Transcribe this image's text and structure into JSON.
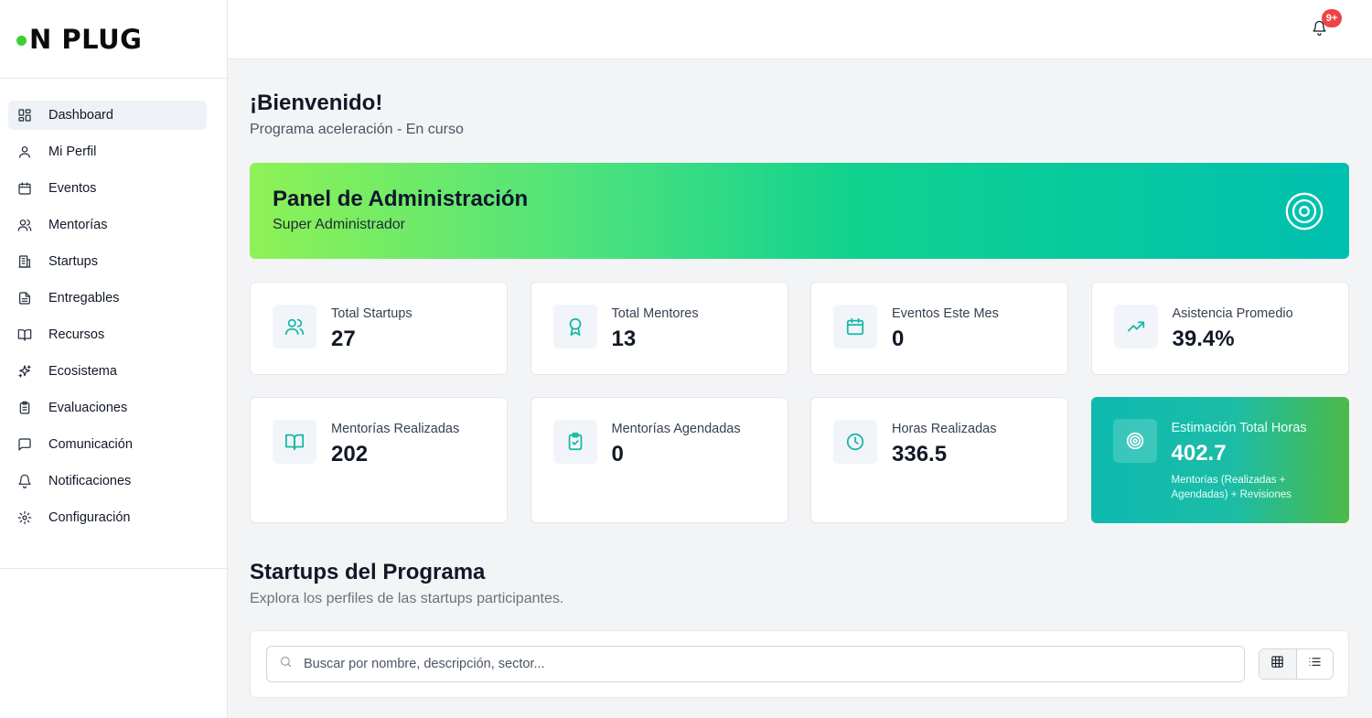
{
  "brand": {
    "name": "N PLUG",
    "dot_color": "#3ecf37"
  },
  "sidebar": {
    "items": [
      {
        "label": "Dashboard",
        "icon": "layout-grid-icon",
        "active": true
      },
      {
        "label": "Mi Perfil",
        "icon": "user-icon"
      },
      {
        "label": "Eventos",
        "icon": "calendar-icon"
      },
      {
        "label": "Mentorías",
        "icon": "users-icon"
      },
      {
        "label": "Startups",
        "icon": "building-icon"
      },
      {
        "label": "Entregables",
        "icon": "file-text-icon"
      },
      {
        "label": "Recursos",
        "icon": "book-open-icon"
      },
      {
        "label": "Ecosistema",
        "icon": "sparkles-icon"
      },
      {
        "label": "Evaluaciones",
        "icon": "clipboard-icon"
      },
      {
        "label": "Comunicación",
        "icon": "message-square-icon"
      },
      {
        "label": "Notificaciones",
        "icon": "bell-icon"
      },
      {
        "label": "Configuración",
        "icon": "settings-icon"
      }
    ]
  },
  "topbar": {
    "notification_badge": "9+",
    "badge_color": "#ef4444"
  },
  "welcome": {
    "title": "¡Bienvenido!",
    "subtitle": "Programa aceleración - En curso"
  },
  "banner": {
    "title": "Panel de Administración",
    "subtitle": "Super Administrador",
    "icon": "target-icon"
  },
  "stats": [
    {
      "label": "Total Startups",
      "value": "27",
      "icon": "users-icon"
    },
    {
      "label": "Total Mentores",
      "value": "13",
      "icon": "award-icon"
    },
    {
      "label": "Eventos Este Mes",
      "value": "0",
      "icon": "calendar-icon"
    },
    {
      "label": "Asistencia Promedio",
      "value": "39.4%",
      "icon": "trending-up-icon"
    },
    {
      "label": "Mentorías Realizadas",
      "value": "202",
      "icon": "book-open-icon"
    },
    {
      "label": "Mentorías Agendadas",
      "value": "0",
      "icon": "clipboard-check-icon"
    },
    {
      "label": "Horas Realizadas",
      "value": "336.5",
      "icon": "clock-icon"
    },
    {
      "label": "Estimación Total Horas",
      "value": "402.7",
      "icon": "target-icon",
      "note": "Mentorías (Realizadas + Agendadas) + Revisiones"
    }
  ],
  "startups_section": {
    "title": "Startups del Programa",
    "subtitle": "Explora los perfiles de las startups participantes.",
    "search_placeholder": "Buscar por nombre, descripción, sector...",
    "search_value": ""
  },
  "colors": {
    "accent_teal": "#14b8a6",
    "banner_start": "#8ef255",
    "banner_end": "#00c0b0"
  }
}
